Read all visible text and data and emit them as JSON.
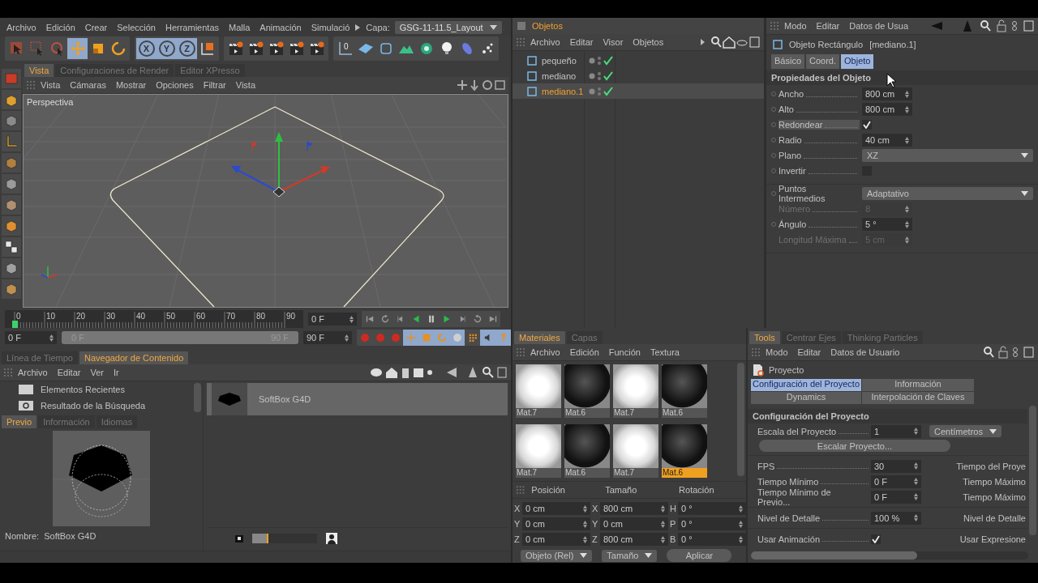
{
  "menu_bar": {
    "items": [
      "Archivo",
      "Edición",
      "Crear",
      "Selección",
      "Herramientas",
      "Malla",
      "Animación",
      "Simulació"
    ],
    "layer_label": "Capa:",
    "layer_value": "GSG-11-11.5_Layout"
  },
  "toolbar": {
    "groups": [
      [
        {
          "kind": "cursor",
          "on": false
        },
        {
          "kind": "rect-select",
          "on": false
        },
        {
          "kind": "circle-select",
          "on": false
        },
        {
          "kind": "move",
          "on": true
        },
        {
          "kind": "scale",
          "on": false
        },
        {
          "kind": "rotate",
          "on": false
        }
      ],
      [
        {
          "kind": "axis",
          "label": "X",
          "on": true
        },
        {
          "kind": "axis",
          "label": "Y",
          "on": true
        },
        {
          "kind": "axis",
          "label": "Z",
          "on": true
        },
        {
          "kind": "coord",
          "on": false
        }
      ],
      [
        {
          "kind": "clapper",
          "on": false
        },
        {
          "kind": "clapper",
          "on": false
        },
        {
          "kind": "clapper",
          "on": false
        },
        {
          "kind": "clapper",
          "on": false
        },
        {
          "kind": "clapper",
          "on": false
        }
      ],
      [
        {
          "kind": "axis-origin",
          "label": "0",
          "on": false
        },
        {
          "kind": "plane",
          "on": false
        },
        {
          "kind": "frame",
          "on": false
        },
        {
          "kind": "hill",
          "on": false
        },
        {
          "kind": "flower",
          "on": false
        },
        {
          "kind": "bulb",
          "on": false
        },
        {
          "kind": "capsule",
          "on": false
        },
        {
          "kind": "dots",
          "on": false
        }
      ]
    ]
  },
  "viewport": {
    "tabs": [
      {
        "label": "Vista",
        "selected": true
      },
      {
        "label": "Configuraciones de Render",
        "selected": false
      },
      {
        "label": "Editor XPresso",
        "selected": false
      }
    ],
    "menu": [
      "Vista",
      "Cámaras",
      "Mostrar",
      "Opciones",
      "Filtrar",
      "Vista"
    ],
    "label": "Perspectiva"
  },
  "timeline": {
    "ticks": [
      "0",
      "10",
      "20",
      "30",
      "40",
      "50",
      "60",
      "70",
      "80",
      "90"
    ],
    "level": 0,
    "current": "0 F",
    "start": "0 F",
    "range": {
      "start": "0 F",
      "end": "90 F",
      "level": 1
    },
    "end": "90 F"
  },
  "content_browser": {
    "tabs": [
      {
        "label": "Línea de Tiempo",
        "selected": false
      },
      {
        "label": "Navegador de Contenido",
        "selected": true
      }
    ],
    "menu": [
      "Archivo",
      "Editar",
      "Ver",
      "Ir"
    ],
    "tree": [
      "Elementos Recientes",
      "Resultado de la Búsqueda"
    ],
    "preview_tabs": [
      {
        "label": "Previo",
        "selected": true
      },
      {
        "label": "Información",
        "selected": false
      },
      {
        "label": "Idiomas",
        "selected": false
      }
    ],
    "name_label": "Nombre:",
    "name_value": "SoftBox G4D",
    "items": [
      {
        "name": "SoftBox G4D",
        "selected": true
      }
    ],
    "zoom": {
      "level": 0.25
    }
  },
  "objects": {
    "title": "Objetos",
    "menu": [
      "Archivo",
      "Editar",
      "Visor",
      "Objetos"
    ],
    "items": [
      {
        "name": "pequeño",
        "selected": false,
        "enabled": true
      },
      {
        "name": "mediano",
        "selected": false,
        "enabled": true
      },
      {
        "name": "mediano.1",
        "selected": true,
        "enabled": true
      }
    ]
  },
  "attributes": {
    "menu": [
      "Modo",
      "Editar",
      "Datos de Usua"
    ],
    "object_type": "Objeto Rectángulo",
    "object_name": "[mediano.1]",
    "tabs": [
      {
        "label": "Básico",
        "selected": false
      },
      {
        "label": "Coord.",
        "selected": false
      },
      {
        "label": "Objeto",
        "selected": true
      }
    ],
    "section": "Propiedades del Objeto",
    "field_groups": [
      [
        {
          "kind": "number",
          "label": "Ancho",
          "value": "800 cm",
          "disabled": false
        },
        {
          "kind": "number",
          "label": "Alto",
          "value": "800 cm",
          "disabled": false
        },
        {
          "kind": "check",
          "label": "Redondear",
          "checked": true,
          "highlighted": true
        },
        {
          "kind": "number",
          "label": "Radio",
          "value": "40 cm",
          "disabled": false
        },
        {
          "kind": "dropdown",
          "label": "Plano",
          "value": "XZ",
          "disabled": false
        },
        {
          "kind": "check",
          "label": "Invertir",
          "checked": false,
          "highlighted": false
        }
      ],
      [
        {
          "kind": "dropdown",
          "label": "Puntos Intermedios",
          "value": "Adaptativo",
          "disabled": false
        },
        {
          "kind": "number",
          "label": "Número",
          "value": "8",
          "disabled": true
        },
        {
          "kind": "number",
          "label": "Ángulo",
          "value": "5 °",
          "disabled": false
        },
        {
          "kind": "number",
          "label": "Longitud Máxima",
          "value": "5 cm",
          "disabled": true
        }
      ]
    ]
  },
  "materials": {
    "tabs": [
      {
        "label": "Materiales",
        "selected": true
      },
      {
        "label": "Capas",
        "selected": false
      }
    ],
    "menu": [
      "Archivo",
      "Edición",
      "Función",
      "Textura"
    ],
    "items": [
      {
        "name": "Mat.7",
        "kind": "white",
        "selected": false
      },
      {
        "name": "Mat.6",
        "kind": "dark",
        "selected": false
      },
      {
        "name": "Mat.7",
        "kind": "white",
        "selected": false
      },
      {
        "name": "Mat.6",
        "kind": "dark",
        "selected": false
      },
      {
        "name": "Mat.7",
        "kind": "white",
        "selected": false
      },
      {
        "name": "Mat.6",
        "kind": "dark",
        "selected": false
      },
      {
        "name": "Mat.7",
        "kind": "white",
        "selected": false
      },
      {
        "name": "Mat.6",
        "kind": "dark",
        "selected": true
      }
    ]
  },
  "coordinates": {
    "headers": [
      "Posición",
      "Tamaño",
      "Rotación"
    ],
    "columns": [
      [
        {
          "axis": "X",
          "value": "0 cm"
        },
        {
          "axis": "Y",
          "value": "0 cm"
        },
        {
          "axis": "Z",
          "value": "0 cm"
        }
      ],
      [
        {
          "axis": "X",
          "value": "800 cm"
        },
        {
          "axis": "Y",
          "value": "0 cm"
        },
        {
          "axis": "Z",
          "value": "800 cm"
        }
      ],
      [
        {
          "axis": "H",
          "value": "0 °"
        },
        {
          "axis": "P",
          "value": "0 °"
        },
        {
          "axis": "B",
          "value": "0 °"
        }
      ]
    ],
    "mode": "Objeto (Rel)",
    "size_mode": "Tamaño",
    "apply": "Aplicar"
  },
  "tools": {
    "tabs": [
      {
        "label": "Tools",
        "selected": true
      },
      {
        "label": "Centrar Ejes",
        "selected": false
      },
      {
        "label": "Thinking Particles",
        "selected": false
      }
    ],
    "menu": [
      "Modo",
      "Editar",
      "Datos de Usuario"
    ],
    "title": "Proyecto",
    "subtabs": [
      {
        "label": "Configuración del Proyecto",
        "selected": true
      },
      {
        "label": "Información",
        "selected": false
      },
      {
        "label": "Dynamics",
        "selected": false
      },
      {
        "label": "Interpolación de Claves",
        "selected": false
      }
    ],
    "section": "Configuración del Proyecto",
    "scale_label": "Escala del Proyecto",
    "scale_value": "1",
    "scale_unit": "Centímetros",
    "scale_button": "Escalar Proyecto...",
    "row_groups": [
      [
        {
          "kind": "number",
          "label": "FPS",
          "value": "30",
          "right": "Tiempo del Proye"
        },
        {
          "kind": "number",
          "label": "Tiempo Mínimo",
          "value": "0 F",
          "right": "Tiempo Máximo"
        },
        {
          "kind": "number",
          "label": "Tiempo Mínimo de Previo...",
          "value": "0 F",
          "right": "Tiempo Máximo"
        }
      ],
      [
        {
          "kind": "number",
          "label": "Nivel de Detalle",
          "value": "100 %",
          "right": "Nivel de Detalle"
        }
      ],
      [
        {
          "kind": "check",
          "label": "Usar Animación",
          "checked": true,
          "right": "Usar Expresione"
        }
      ]
    ]
  }
}
